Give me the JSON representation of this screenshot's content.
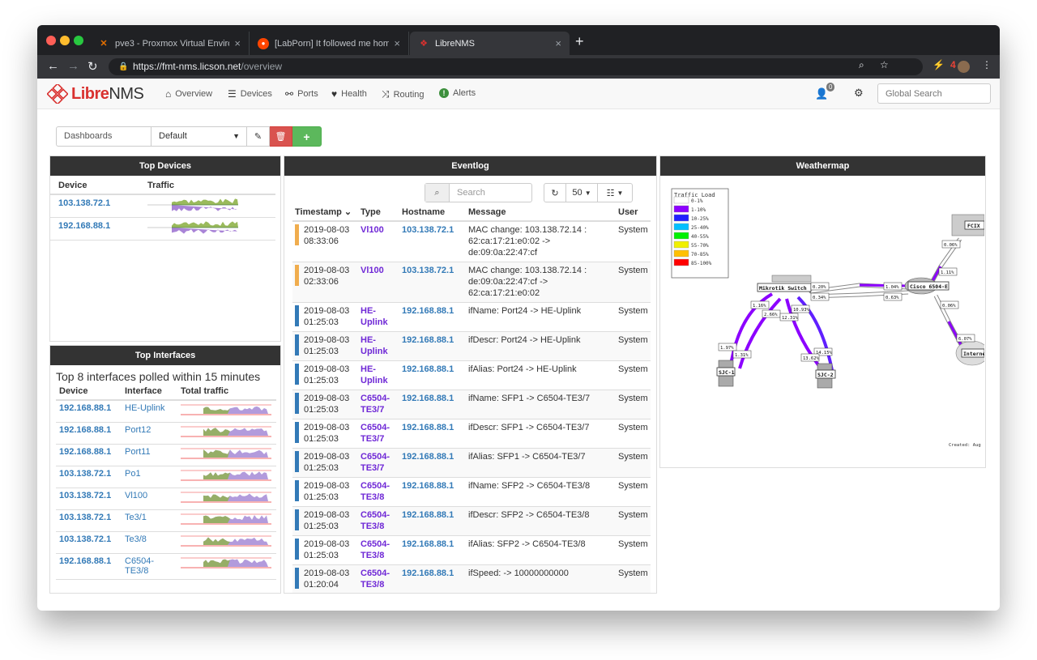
{
  "browser": {
    "tabs": [
      {
        "title": "pve3 - Proxmox Virtual Environ",
        "favicon": "proxmox-icon"
      },
      {
        "title": "[LabPorn] It followed me home",
        "favicon": "reddit-icon"
      },
      {
        "title": "LibreNMS",
        "favicon": "librenms-icon"
      }
    ],
    "url_host": "https://fmt-nms.licson.net",
    "url_path": "/overview",
    "extension_badge": "4"
  },
  "nav": {
    "brand_libre": "Libre",
    "brand_nms": "NMS",
    "items": [
      {
        "label": "Overview",
        "icon": "home-icon"
      },
      {
        "label": "Devices",
        "icon": "server-icon"
      },
      {
        "label": "Ports",
        "icon": "link-icon"
      },
      {
        "label": "Health",
        "icon": "heartbeat-icon"
      },
      {
        "label": "Routing",
        "icon": "random-icon"
      },
      {
        "label": "Alerts",
        "icon": "exclamation-circle-icon"
      }
    ],
    "notification_count": "0",
    "search_placeholder": "Global Search"
  },
  "dashboard": {
    "label": "Dashboards",
    "selected": "Default"
  },
  "top_devices": {
    "title": "Top Devices",
    "col_device": "Device",
    "col_traffic": "Traffic",
    "rows": [
      {
        "device": "103.138.72.1"
      },
      {
        "device": "192.168.88.1"
      }
    ]
  },
  "top_interfaces": {
    "title": "Top Interfaces",
    "note": "Top 8 interfaces polled within 15 minutes",
    "col_device": "Device",
    "col_interface": "Interface",
    "col_traffic": "Total traffic",
    "rows": [
      {
        "device": "192.168.88.1",
        "interface": "HE-Uplink"
      },
      {
        "device": "192.168.88.1",
        "interface": "Port12"
      },
      {
        "device": "192.168.88.1",
        "interface": "Port11"
      },
      {
        "device": "103.138.72.1",
        "interface": "Po1"
      },
      {
        "device": "103.138.72.1",
        "interface": "Vl100"
      },
      {
        "device": "103.138.72.1",
        "interface": "Te3/1"
      },
      {
        "device": "103.138.72.1",
        "interface": "Te3/8"
      },
      {
        "device": "192.168.88.1",
        "interface": "C6504-TE3/8"
      }
    ]
  },
  "eventlog": {
    "title": "Eventlog",
    "search_placeholder": "Search",
    "page_size": "50",
    "cols": {
      "timestamp": "Timestamp",
      "type": "Type",
      "hostname": "Hostname",
      "message": "Message",
      "user": "User"
    },
    "rows": [
      {
        "date": "2019-08-03",
        "time": "08:33:06",
        "type": "Vl100",
        "host": "103.138.72.1",
        "msg": "MAC change: 103.138.72.14 : 62:ca:17:21:e0:02 -> de:09:0a:22:47:cf",
        "user": "System",
        "sev_color": "#f0ad4e"
      },
      {
        "date": "2019-08-03",
        "time": "02:33:06",
        "type": "Vl100",
        "host": "103.138.72.1",
        "msg": "MAC change: 103.138.72.14 : de:09:0a:22:47:cf -> 62:ca:17:21:e0:02",
        "user": "System",
        "sev_color": "#f0ad4e"
      },
      {
        "date": "2019-08-03",
        "time": "01:25:03",
        "type": "HE-Uplink",
        "host": "192.168.88.1",
        "msg": "ifName: Port24 -> HE-Uplink",
        "user": "System",
        "sev_color": "#337ab7"
      },
      {
        "date": "2019-08-03",
        "time": "01:25:03",
        "type": "HE-Uplink",
        "host": "192.168.88.1",
        "msg": "ifDescr: Port24 -> HE-Uplink",
        "user": "System",
        "sev_color": "#337ab7"
      },
      {
        "date": "2019-08-03",
        "time": "01:25:03",
        "type": "HE-Uplink",
        "host": "192.168.88.1",
        "msg": "ifAlias: Port24 -> HE-Uplink",
        "user": "System",
        "sev_color": "#337ab7"
      },
      {
        "date": "2019-08-03",
        "time": "01:25:03",
        "type": "C6504-TE3/7",
        "host": "192.168.88.1",
        "msg": "ifName: SFP1 -> C6504-TE3/7",
        "user": "System",
        "sev_color": "#337ab7"
      },
      {
        "date": "2019-08-03",
        "time": "01:25:03",
        "type": "C6504-TE3/7",
        "host": "192.168.88.1",
        "msg": "ifDescr: SFP1 -> C6504-TE3/7",
        "user": "System",
        "sev_color": "#337ab7"
      },
      {
        "date": "2019-08-03",
        "time": "01:25:03",
        "type": "C6504-TE3/7",
        "host": "192.168.88.1",
        "msg": "ifAlias: SFP1 -> C6504-TE3/7",
        "user": "System",
        "sev_color": "#337ab7"
      },
      {
        "date": "2019-08-03",
        "time": "01:25:03",
        "type": "C6504-TE3/8",
        "host": "192.168.88.1",
        "msg": "ifName: SFP2 -> C6504-TE3/8",
        "user": "System",
        "sev_color": "#337ab7"
      },
      {
        "date": "2019-08-03",
        "time": "01:25:03",
        "type": "C6504-TE3/8",
        "host": "192.168.88.1",
        "msg": "ifDescr: SFP2 -> C6504-TE3/8",
        "user": "System",
        "sev_color": "#337ab7"
      },
      {
        "date": "2019-08-03",
        "time": "01:25:03",
        "type": "C6504-TE3/8",
        "host": "192.168.88.1",
        "msg": "ifAlias: SFP2 -> C6504-TE3/8",
        "user": "System",
        "sev_color": "#337ab7"
      },
      {
        "date": "2019-08-03",
        "time": "01:20:04",
        "type": "C6504-TE3/8",
        "host": "192.168.88.1",
        "msg": "ifSpeed: -> 10000000000",
        "user": "System",
        "sev_color": "#337ab7"
      }
    ]
  },
  "weathermap": {
    "title": "Weathermap",
    "legend_title": "Traffic Load",
    "legend": [
      {
        "label": "0-1%",
        "color": "#ffffff"
      },
      {
        "label": "1-10%",
        "color": "#8c00ff"
      },
      {
        "label": "10-25%",
        "color": "#2020ff"
      },
      {
        "label": "25-40%",
        "color": "#00c0ff"
      },
      {
        "label": "40-55%",
        "color": "#00f000"
      },
      {
        "label": "55-70%",
        "color": "#f0f000"
      },
      {
        "label": "70-85%",
        "color": "#ffc000"
      },
      {
        "label": "85-100%",
        "color": "#ff0000"
      }
    ],
    "nodes": {
      "mikrotik": "Mikrotik Switch",
      "cisco": "Cisco 6504-E",
      "fcix": "FCIX",
      "internet": "Interne",
      "sjc1": "SJC-1",
      "sjc2": "SJC-2"
    },
    "link_labels": [
      "0.20%",
      "0.34%",
      "1.04%",
      "0.63%",
      "1.11%",
      "0.06%",
      "0.06%",
      "6.07%",
      "1.16%",
      "2.66%",
      "12.31%",
      "10.93%",
      "1.97%",
      "1.31%",
      "14.15%",
      "13.62%"
    ],
    "created": "Created: Aug"
  }
}
